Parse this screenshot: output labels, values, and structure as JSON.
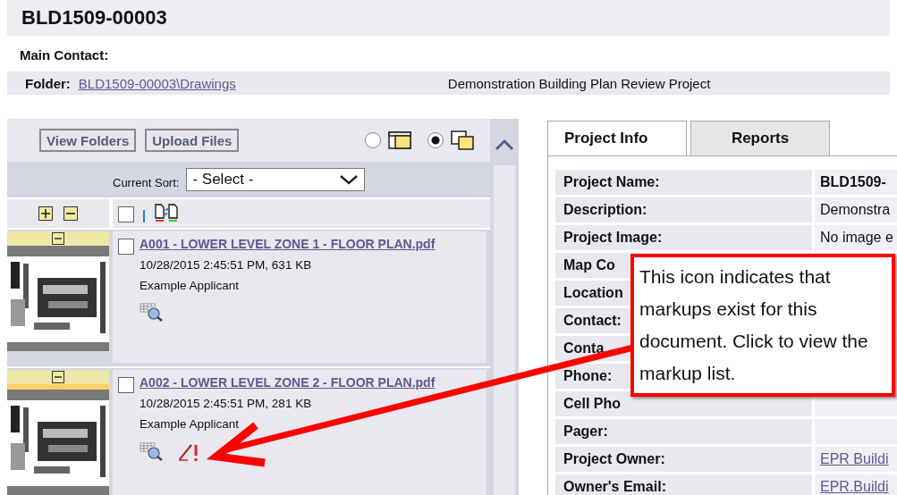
{
  "page_title": "BLD1509-00003",
  "main_contact_label": "Main Contact:",
  "folder": {
    "label": "Folder:",
    "path": "BLD1509-00003\\Drawings",
    "description": "Demonstration Building Plan Review Project"
  },
  "toolbar": {
    "buttons": [
      "View Folders",
      "Upload Files"
    ],
    "view_modes": [
      {
        "kind": "list",
        "selected": false
      },
      {
        "kind": "tiles",
        "selected": true
      }
    ]
  },
  "sort": {
    "label": "Current Sort:",
    "value": "- Select -"
  },
  "header_checkbox": {
    "checked": false
  },
  "documents": [
    {
      "name": "A001 - LOWER LEVEL ZONE 1 - FLOOR PLAN.pdf",
      "meta": "10/28/2015 2:45:51 PM, 631 KB",
      "author": "Example Applicant",
      "checked": false,
      "selected": false,
      "has_markups": false
    },
    {
      "name": "A002 - LOWER LEVEL ZONE 2 - FLOOR PLAN.pdf",
      "meta": "10/28/2015 2:45:51 PM, 281 KB",
      "author": "Example Applicant",
      "checked": false,
      "selected": true,
      "has_markups": true
    }
  ],
  "tabs": [
    {
      "label": "Project Info",
      "selected": true
    },
    {
      "label": "Reports",
      "selected": false
    }
  ],
  "project_info": [
    {
      "label": "Project Name:",
      "value": "BLD1509-",
      "kind": "bold"
    },
    {
      "label": "Description:",
      "value": "Demonstra",
      "kind": "text"
    },
    {
      "label": "Project Image:",
      "value": "No image e",
      "kind": "text"
    },
    {
      "label": "Map Co",
      "kind": "text"
    },
    {
      "label": "Location",
      "kind": "text"
    },
    {
      "label": "Contact:",
      "kind": "text"
    },
    {
      "label": "Conta",
      "kind": "text"
    },
    {
      "label": "Phone:",
      "kind": "text"
    },
    {
      "label": "Cell Pho",
      "kind": "text"
    },
    {
      "label": "Pager:",
      "kind": "text"
    },
    {
      "label": "Project Owner:",
      "value": "EPR Buildi",
      "kind": "link"
    },
    {
      "label": "Owner's Email:",
      "value": "EPR.Buildi",
      "kind": "link"
    }
  ],
  "callout": "This icon indicates that markups exist for this document. Click to view the markup list."
}
